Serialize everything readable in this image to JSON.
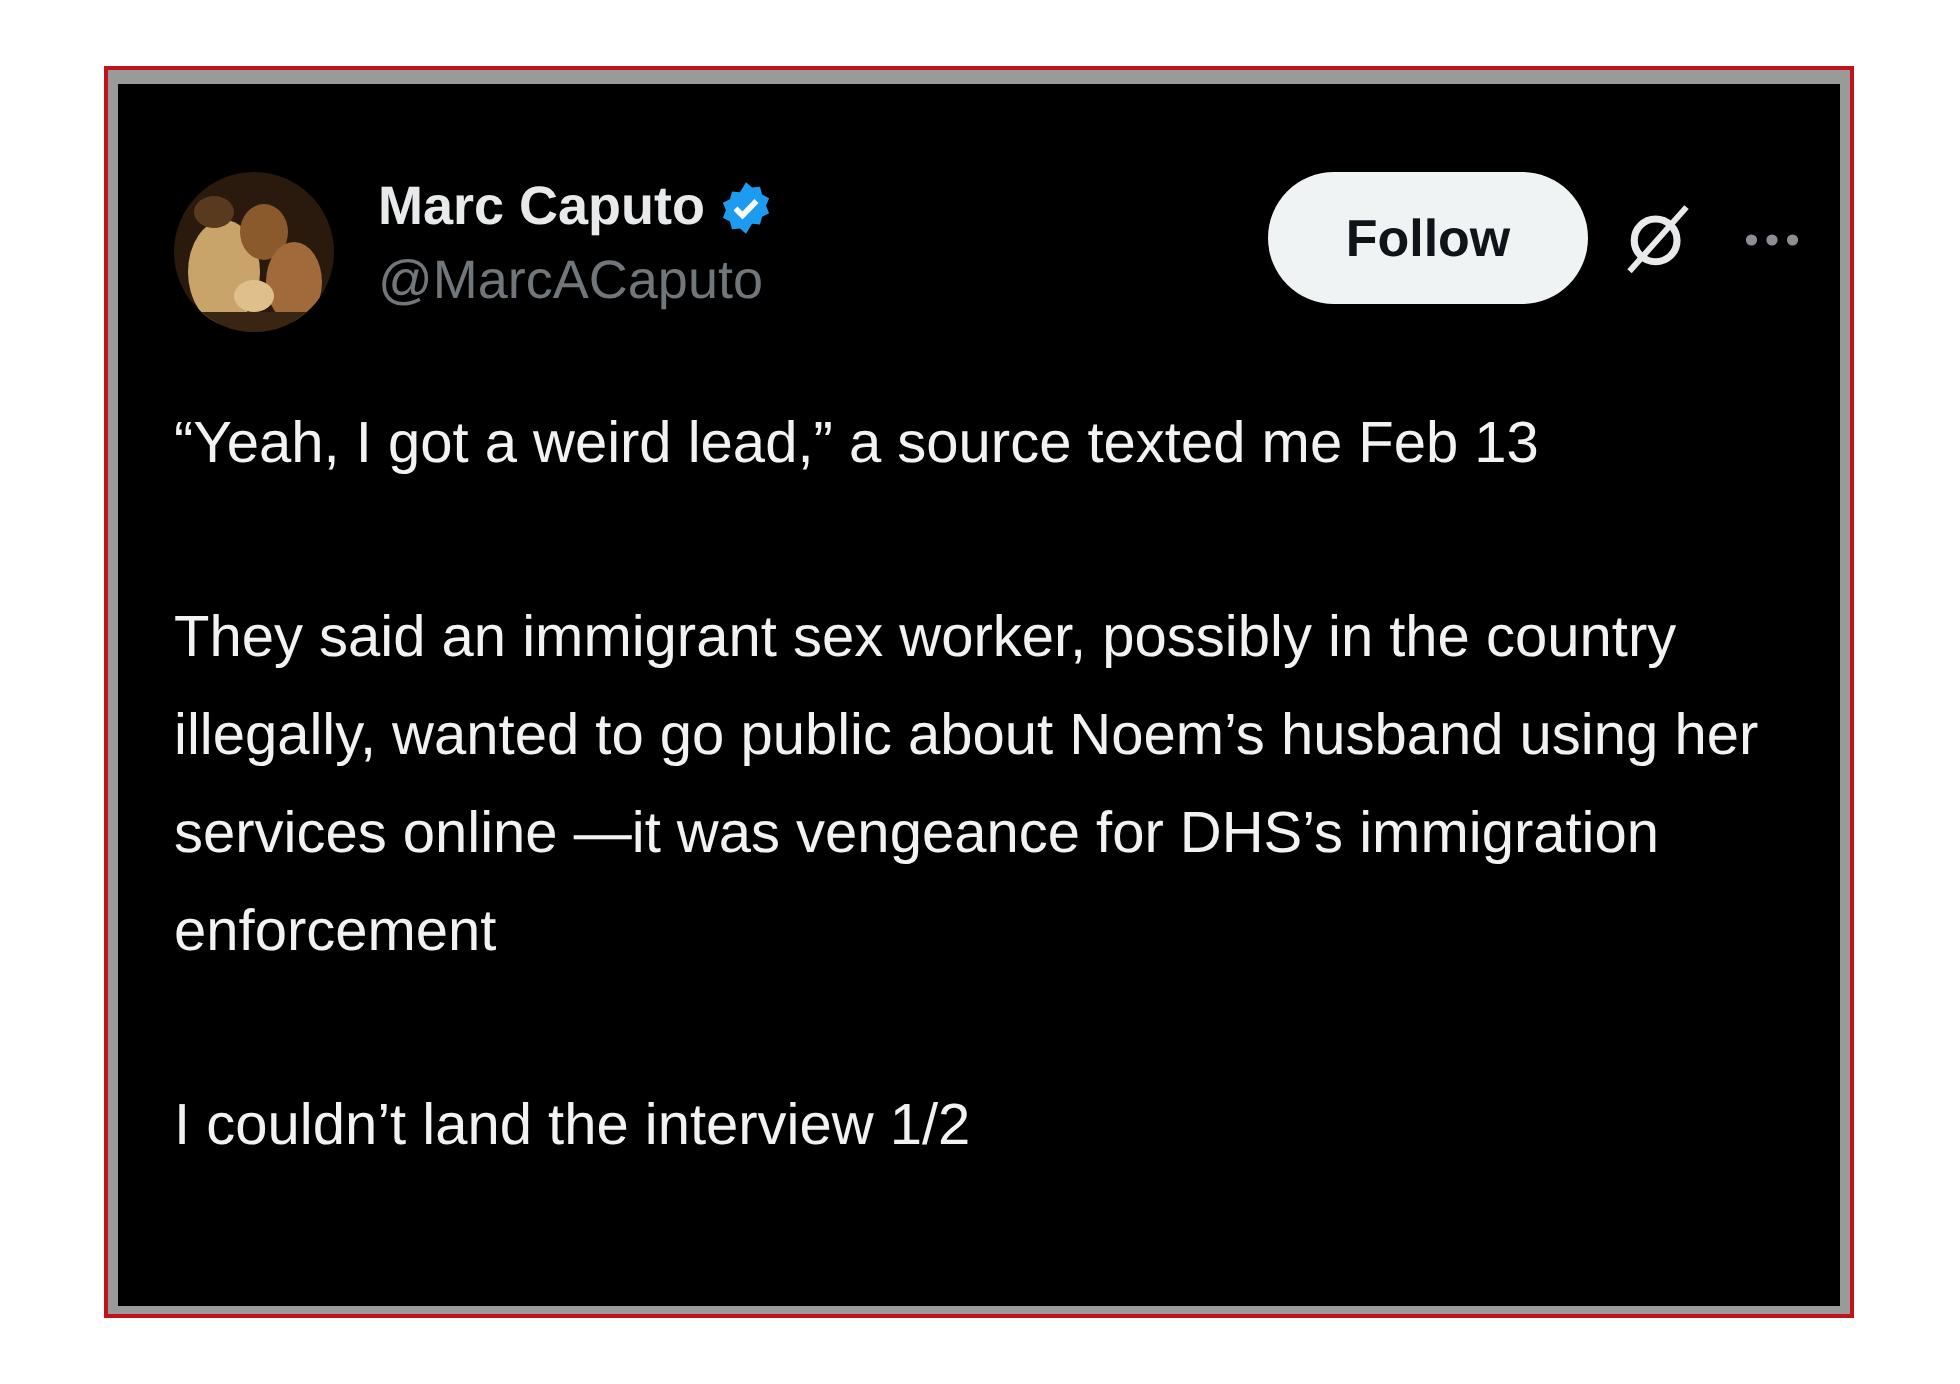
{
  "author": {
    "name": "Marc Caputo",
    "verified": true,
    "handle": "@MarcACaputo"
  },
  "follow_button": {
    "label": "Follow"
  },
  "paragraphs": [
    "“Yeah, I got a weird lead,” a source texted me Feb 13",
    "They said an immigrant sex worker, possibly in the country illegally, wanted to go public about Noem’s husband using her services online —it was vengeance for DHS’s immigration enforcement",
    "I couldn’t land the interview 1/2"
  ]
}
